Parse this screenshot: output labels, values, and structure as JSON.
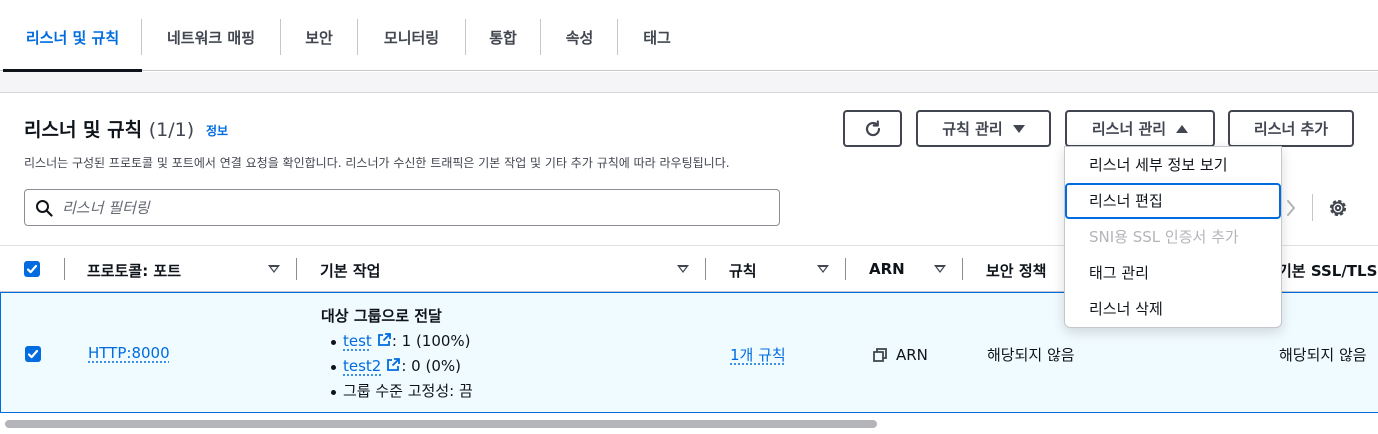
{
  "tabs": [
    {
      "label": "리스너 및 규칙",
      "active": true
    },
    {
      "label": "네트워크 매핑",
      "active": false
    },
    {
      "label": "보안",
      "active": false
    },
    {
      "label": "모니터링",
      "active": false
    },
    {
      "label": "통합",
      "active": false
    },
    {
      "label": "속성",
      "active": false
    },
    {
      "label": "태그",
      "active": false
    }
  ],
  "panel": {
    "title": "리스너 및 규칙",
    "count": "(1/1)",
    "info": "정보",
    "description": "리스너는 구성된 프로토콜 및 포트에서 연결 요청을 확인합니다. 리스너가 수신한 트래픽은 기본 작업 및 기타 추가 규칙에 따라 라우팅됩니다."
  },
  "actions": {
    "refresh_icon": "refresh-icon",
    "manage_rules": "규칙 관리",
    "manage_listener": "리스너 관리",
    "add_listener": "리스너 추가"
  },
  "search": {
    "placeholder": "리스너 필터링",
    "value": ""
  },
  "dropdown": {
    "items": [
      {
        "label": "리스너 세부 정보 보기",
        "state": "normal"
      },
      {
        "label": "리스너 편집",
        "state": "focused"
      },
      {
        "label": "SNI용 SSL 인증서 추가",
        "state": "disabled"
      },
      {
        "label": "태그 관리",
        "state": "normal"
      },
      {
        "label": "리스너 삭제",
        "state": "normal"
      }
    ]
  },
  "table": {
    "headers": {
      "protocol_port": "프로토콜: 포트",
      "default_action": "기본 작업",
      "rules": "규칙",
      "arn": "ARN",
      "security_policy": "보안 정책",
      "default_ssl": "기본 SSL/TLS"
    },
    "rows": [
      {
        "selected": true,
        "protocol_port": "HTTP:8000",
        "action_title": "대상 그룹으로 전달",
        "targets": [
          {
            "name": "test",
            "weight": ": 1 (100%)"
          },
          {
            "name": "test2",
            "weight": ": 0 (0%)"
          }
        ],
        "stickiness": "그룹 수준 고정성: 끔",
        "rules": "1개 규칙",
        "arn": "ARN",
        "security_policy": "해당되지 않음",
        "default_ssl": "해당되지 않음"
      }
    ]
  },
  "colors": {
    "accent": "#006ce0",
    "text": "#0f141a",
    "muted": "#424650",
    "selected_row_bg": "#f0fbff"
  }
}
